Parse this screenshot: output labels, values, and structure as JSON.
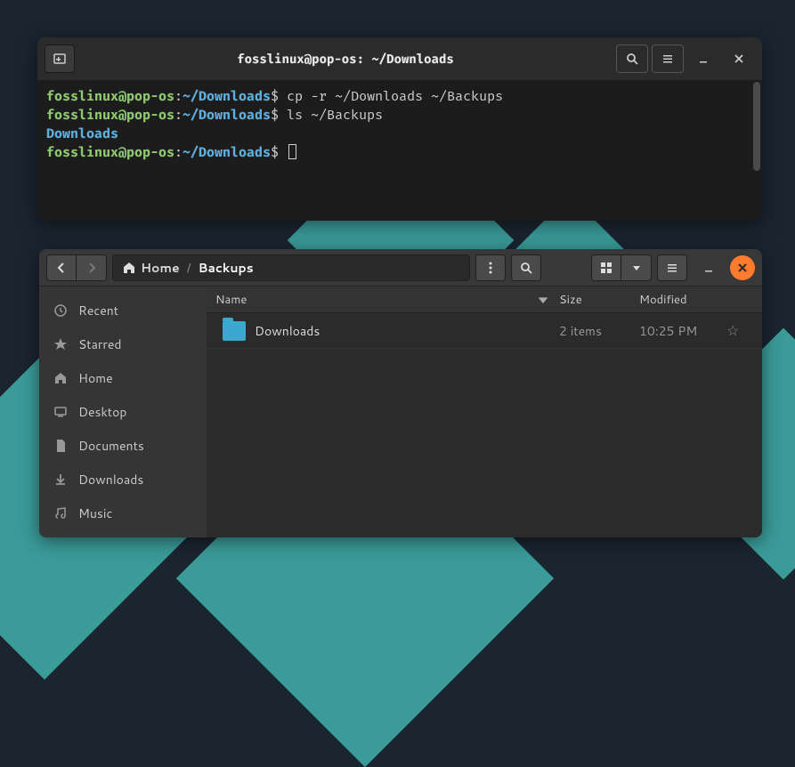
{
  "terminal": {
    "title": "fosslinux@pop-os: ~/Downloads",
    "prompt_user": "fosslinux@pop-os",
    "prompt_sep": ":",
    "prompt_path": "~/Downloads",
    "prompt_dollar": "$ ",
    "lines": [
      {
        "cmd": "cp -r ~/Downloads ~/Backups"
      },
      {
        "cmd": "ls ~/Backups"
      }
    ],
    "ls_output": "Downloads"
  },
  "fm": {
    "breadcrumb": {
      "home": "Home",
      "current": "Backups"
    },
    "sidebar": [
      {
        "label": "Recent"
      },
      {
        "label": "Starred"
      },
      {
        "label": "Home"
      },
      {
        "label": "Desktop"
      },
      {
        "label": "Documents"
      },
      {
        "label": "Downloads"
      },
      {
        "label": "Music"
      }
    ],
    "columns": {
      "name": "Name",
      "size": "Size",
      "modified": "Modified"
    },
    "rows": [
      {
        "name": "Downloads",
        "size": "2 items",
        "modified": "10:25 PM"
      }
    ]
  }
}
